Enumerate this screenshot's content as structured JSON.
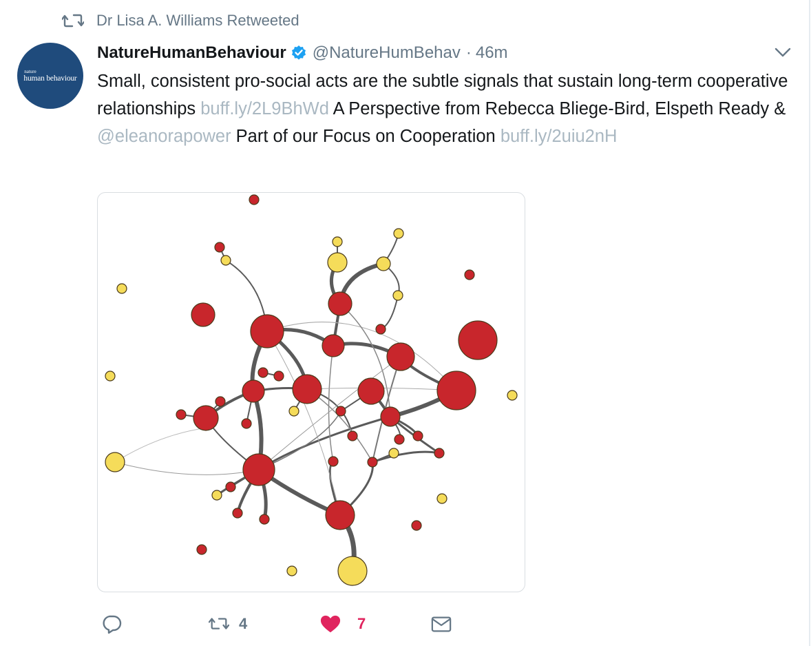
{
  "retweet_context": {
    "text": "Dr Lisa A. Williams Retweeted",
    "icon": "retweet-icon"
  },
  "author": {
    "display_name": "NatureHumanBehaviour",
    "handle": "@NatureHumBehav",
    "verified": true,
    "avatar_small_text": "nature",
    "avatar_big_text": "human behaviour",
    "avatar_color": "#1f4b7c"
  },
  "meta": {
    "separator": "·",
    "time": "46m"
  },
  "tweet": {
    "part1": "Small, consistent pro-social acts are the subtle signals that sustain long-term cooperative relationships ",
    "link1": "buff.ly/2L9BhWd",
    "part2": " A Perspective from Rebecca Bliege-Bird, Elspeth Ready & ",
    "mention": "@eleanorapower",
    "part3": " Part of our Focus on Cooperation ",
    "link2": "buff.ly/2uiu2nH"
  },
  "actions": {
    "reply_count": "",
    "retweet_count": "4",
    "like_count": "7",
    "liked": true
  },
  "colors": {
    "link": "#aab8c2",
    "like": "#e0245e",
    "verified": "#1da1f2",
    "node_red": "#c8262c",
    "node_yellow": "#f5dc5a"
  }
}
